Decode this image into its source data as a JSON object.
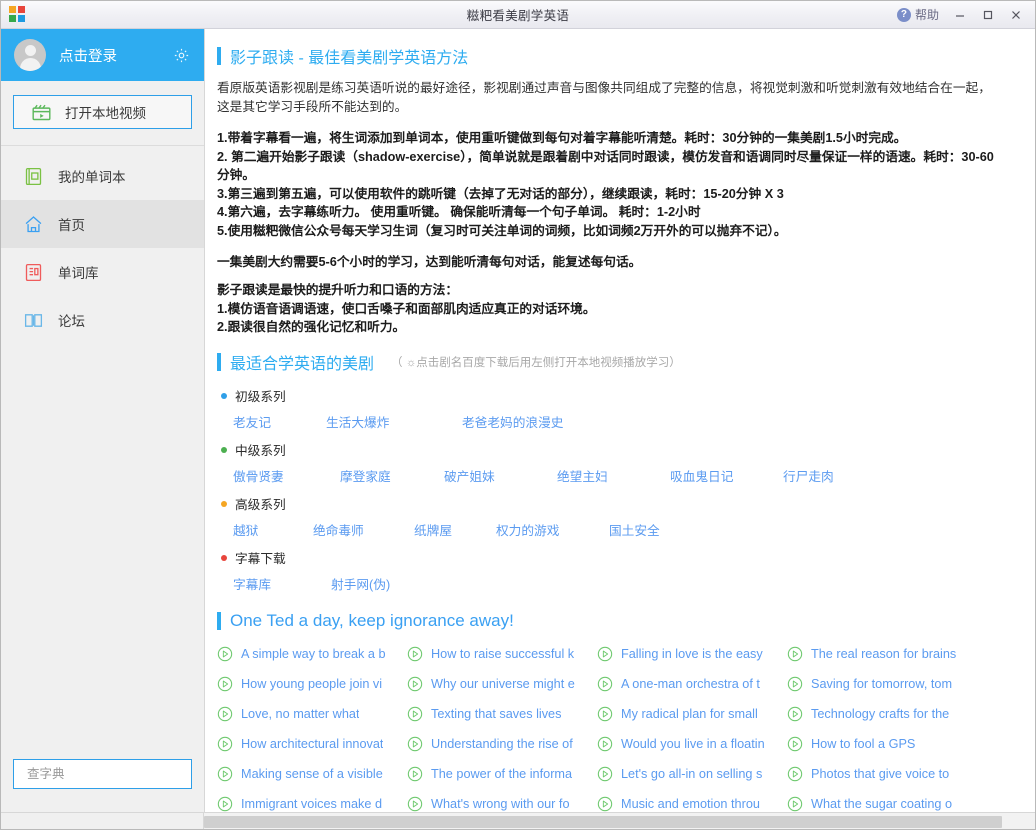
{
  "window": {
    "title": "糍粑看美剧学英语",
    "help_label": "帮助",
    "help_icon": "question-circle-icon",
    "minimize_icon": "minimize-icon",
    "maximize_icon": "maximize-icon",
    "close_icon": "close-icon",
    "logo_icon": "pinwheel-logo-icon"
  },
  "sidebar": {
    "profile": {
      "label": "点击登录",
      "avatar_icon": "user-avatar-icon",
      "settings_icon": "gear-icon"
    },
    "open_video": {
      "label": "打开本地视频",
      "icon": "film-clapper-icon"
    },
    "items": [
      {
        "label": "我的单词本",
        "icon": "notebook-icon",
        "active": false
      },
      {
        "label": "首页",
        "icon": "home-icon",
        "active": true
      },
      {
        "label": "单词库",
        "icon": "wordbank-icon",
        "active": false
      },
      {
        "label": "论坛",
        "icon": "book-open-icon",
        "active": false
      }
    ],
    "search": {
      "placeholder": "查字典",
      "value": "",
      "icon": "search-icon"
    }
  },
  "main": {
    "section1": {
      "title": "影子跟读 - 最佳看美剧学英语方法",
      "intro": "看原版英语影视剧是练习英语听说的最好途径，影视剧通过声音与图像共同组成了完整的信息，将视觉刺激和听觉刺激有效地结合在一起，这是其它学习手段所不能达到的。",
      "steps": [
        "1.带着字幕看一遍，将生词添加到单词本，使用重听键做到每句对着字幕能听清楚。耗时：30分钟的一集美剧1.5小时完成。",
        "2. 第二遍开始影子跟读（shadow-exercise），简单说就是跟着剧中对话同时跟读，模仿发音和语调同时尽量保证一样的语速。耗时：30-60分钟。",
        "3.第三遍到第五遍，可以使用软件的跳听键（去掉了无对话的部分），继续跟读，耗时：15-20分钟 X 3",
        "4.第六遍，去字幕练听力。 使用重听键。 确保能听清每一个句子单词。 耗时：1-2小时",
        "5.使用糍粑微信公众号每天学习生词（复习时可关注单词的词频，比如词频2万开外的可以抛弃不记）。"
      ],
      "summary": "一集美剧大约需要5-6个小时的学习，达到能听清每句对话，能复述每句话。",
      "benefits_title": "影子跟读是最快的提升听力和口语的方法：",
      "benefits": [
        "1.模仿语音语调语速，使口舌嗓子和面部肌肉适应真正的对话环境。",
        "2.跟读很自然的强化记忆和听力。"
      ]
    },
    "section2": {
      "title": "最适合学英语的美剧",
      "note": "（ ☼点击剧名百度下载后用左侧打开本地视频播放学习）",
      "groups": [
        {
          "label": "初级系列",
          "dot_color": "#2f9fe8",
          "shows": [
            "老友记",
            "生活大爆炸",
            "老爸老妈的浪漫史"
          ]
        },
        {
          "label": "中级系列",
          "dot_color": "#4caf50",
          "shows": [
            "傲骨贤妻",
            "摩登家庭",
            "破产姐妹",
            "绝望主妇",
            "吸血鬼日记",
            "行尸走肉"
          ]
        },
        {
          "label": "高级系列",
          "dot_color": "#f5a623",
          "shows": [
            "越狱",
            "绝命毒师",
            "纸牌屋",
            "权力的游戏",
            "国土安全"
          ]
        },
        {
          "label": "字幕下载",
          "dot_color": "#e8453c",
          "shows": [
            "字幕库",
            "射手网(伪)"
          ]
        }
      ]
    },
    "section3": {
      "title": "One Ted a day, keep ignorance away!",
      "play_icon": "play-circle-icon",
      "talks": [
        "A simple way to break a b",
        "How to raise successful k",
        "Falling in love is the easy",
        "The real reason for brains",
        "How young people join vi",
        "Why our universe might e",
        "A one-man orchestra of t",
        "Saving for tomorrow, tom",
        "Love, no matter what",
        "Texting that saves lives",
        "My radical plan for small",
        "Technology crafts for the",
        "How architectural innovat",
        "Understanding the rise of",
        "Would you live in a floatin",
        "How to fool a GPS",
        "Making sense of a visible",
        "The power of the informa",
        "Let's go all-in on selling s",
        "Photos that give voice to",
        "Immigrant voices make d",
        "What's wrong with our fo",
        "Music and emotion throu",
        "What the sugar coating o"
      ]
    }
  },
  "colors": {
    "accent": "#2eacf0",
    "link": "#5b9bf0",
    "sidebar_bg": "#f0f0f0",
    "profile_bg": "#2eacf0",
    "play_green": "#6fc96f"
  }
}
